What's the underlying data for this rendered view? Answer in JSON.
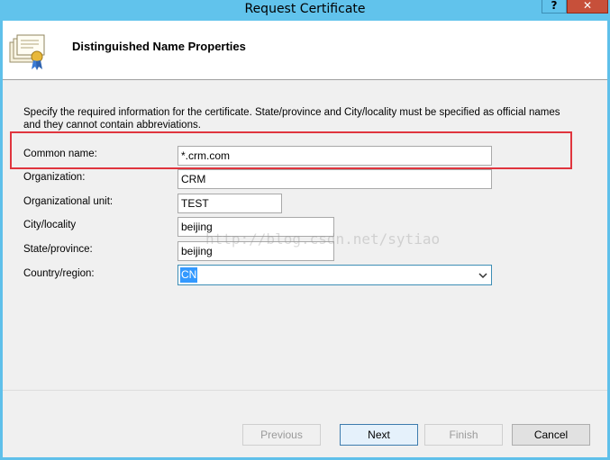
{
  "window": {
    "title": "Request Certificate",
    "help_label": "?",
    "close_label": "✕"
  },
  "header": {
    "title": "Distinguished Name Properties",
    "icon": "certificate-icon"
  },
  "description": "Specify the required information for the certificate. State/province and City/locality must be specified as official names and they cannot contain abbreviations.",
  "fields": {
    "common_name": {
      "label": "Common name:",
      "value": "*.crm.com"
    },
    "organization": {
      "label": "Organization:",
      "value": "CRM"
    },
    "organizational_unit": {
      "label": "Organizational unit:",
      "value": "TEST"
    },
    "city": {
      "label": "City/locality",
      "value": "beijing"
    },
    "state": {
      "label": "State/province:",
      "value": "beijing"
    },
    "country": {
      "label": "Country/region:",
      "value": "CN"
    }
  },
  "watermark": "http://blog.csdn.net/sytiao",
  "buttons": {
    "previous": "Previous",
    "next": "Next",
    "finish": "Finish",
    "cancel": "Cancel"
  },
  "colors": {
    "titlebar": "#61c3ec",
    "close": "#c7503a",
    "highlight": "#e0353e",
    "selection": "#3399ff"
  }
}
